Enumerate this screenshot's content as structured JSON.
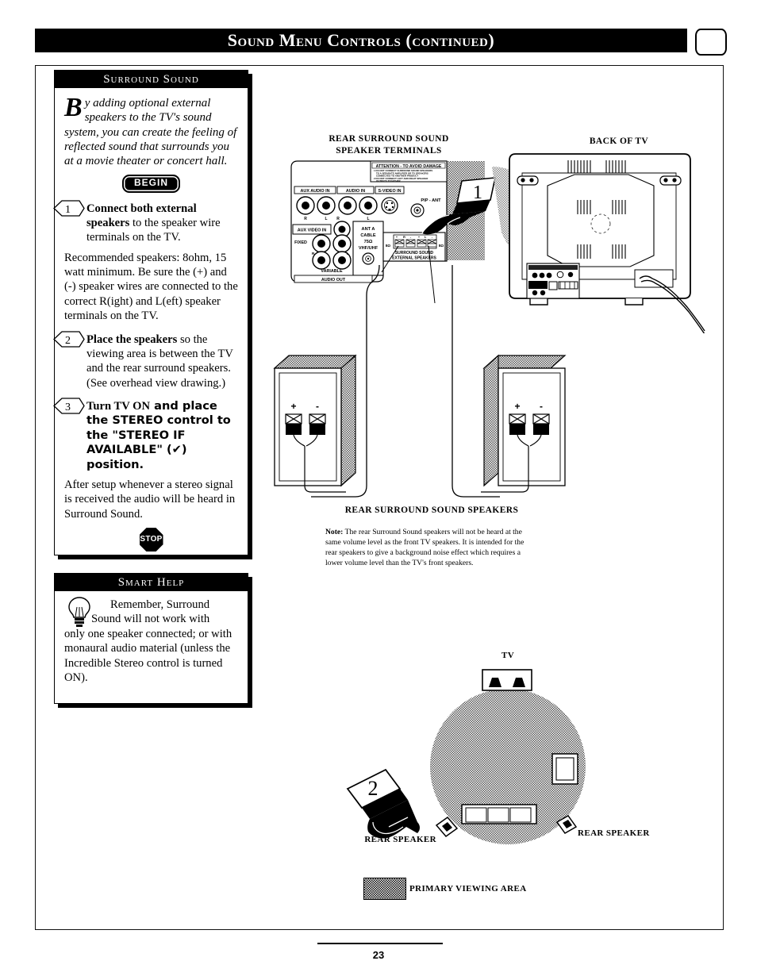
{
  "header": {
    "title": "Sound Menu Controls (continued)",
    "tv_icon": "tv-screen-icon"
  },
  "surround_box": {
    "heading": "Surround Sound",
    "intro_dropcap": "B",
    "intro": "y adding optional external speakers to the TV's sound system, you can create the feeling of reflected sound that surrounds you at a movie theater or concert hall.",
    "begin_label": "BEGIN",
    "stop_label": "STOP",
    "steps": [
      {
        "number": "1",
        "lead": "Connect both external speakers",
        "rest": " to the speaker wire terminals on the TV.",
        "para": "Recommended speakers: 8ohm, 15 watt minimum. Be sure the (+) and (-) speaker wires are connected to the correct R(ight) and L(eft) speaker terminals on the TV."
      },
      {
        "number": "2",
        "lead": "Place the speakers",
        "rest": " so the viewing area is between the TV and the rear surround speakers. (See overhead view drawing.)",
        "para": ""
      },
      {
        "number": "3",
        "lead": "Turn TV ON",
        "rest": " and place the STEREO control to the \"STEREO IF AVAILABLE\" (✔) position.",
        "para": "After setup whenever a stereo signal is received the audio will be heard in Surround Sound."
      }
    ]
  },
  "smart_help": {
    "heading": "Smart Help",
    "icon": "light-bulb-icon",
    "line1": "Remember, Surround",
    "line2": "Sound will not work with",
    "line3": "only one speaker connected; or with monaural audio material (unless the Incredible Stereo control is turned ON)."
  },
  "illustrations": {
    "terminals_caption_line1": "REAR  SURROUND SOUND",
    "terminals_caption_line2": "SPEAKER TERMINALS",
    "back_of_tv_caption": "BACK OF TV",
    "speakers_caption": "REAR SURROUND SOUND SPEAKERS",
    "callout_1": "1",
    "callout_2": "2",
    "panel": {
      "attention_title": "ATTENTION - TO AVOID DAMAGE",
      "attention_line1": "1  DO NOT CONNECT SURROUND SOUND SPEAKERS",
      "attention_line2": "TO A SEPARATE AMPLIFIER OR TO SPEAKERS",
      "attention_line3": "CONNECTED TO ANOTHER PRODUCT",
      "attention_line4": "2  DO NOT CONNECT LEFT AND RIGHT SPEAKER",
      "attention_line5": "OUTPUTS TOGETHER",
      "aux_audio_in": "AUX AUDIO IN",
      "audio_in": "AUDIO IN",
      "s_video_in": "S-VIDEO IN",
      "aux_video_in": "AUX VIDEO IN",
      "pip_ant": "PIP - ANT",
      "ant_a": "ANT A",
      "cable": "CABLE",
      "ohm75": "75Ω",
      "vhf_uhf": "VHF/UHF",
      "fixed": "FIXED",
      "variable": "VARIABLE",
      "audio_out": "AUDIO OUT",
      "r": "R",
      "l": "L",
      "ohm8": "8Ω",
      "plus": "+",
      "minus": "-",
      "surround_line1": "SURROUND SOUND",
      "surround_line2": "EXTERNAL SPEAKERS"
    },
    "speaker_terminal_plus": "+",
    "speaker_terminal_minus": "-"
  },
  "note": {
    "label": "Note:",
    "text": " The rear Surround Sound speakers will not be heard at the same volume level as the front TV speakers. It is intended for the rear speakers to give a background noise effect which requires a lower volume level than the TV's front speakers."
  },
  "overhead": {
    "tv_label": "TV",
    "rear_speaker_left": "REAR SPEAKER",
    "rear_speaker_right": "REAR SPEAKER",
    "legend": "PRIMARY VIEWING AREA"
  },
  "footer": {
    "page_number": "23"
  }
}
